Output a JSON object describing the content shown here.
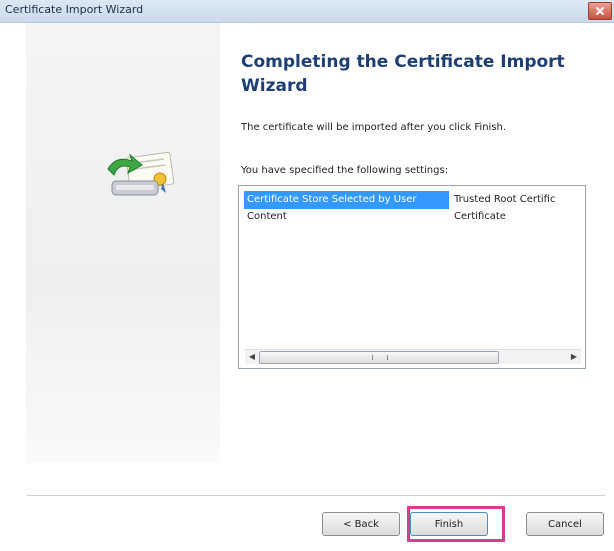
{
  "window": {
    "title": "Certificate Import Wizard",
    "close_icon": "close-icon"
  },
  "wizard": {
    "heading": "Completing the Certificate Import Wizard",
    "intro": "The certificate will be imported after you click Finish.",
    "settings_label": "You have specified the following settings:",
    "settings": [
      {
        "label": "Certificate Store Selected by User",
        "value": "Trusted Root Certific",
        "selected": true
      },
      {
        "label": "Content",
        "value": "Certificate",
        "selected": false
      }
    ],
    "art_icon": "certificate-wizard-icon"
  },
  "buttons": {
    "back": "< Back",
    "finish": "Finish",
    "cancel": "Cancel"
  },
  "colors": {
    "selection": "#3399ff",
    "heading": "#1f3f73",
    "highlight": "#d63d8c"
  }
}
